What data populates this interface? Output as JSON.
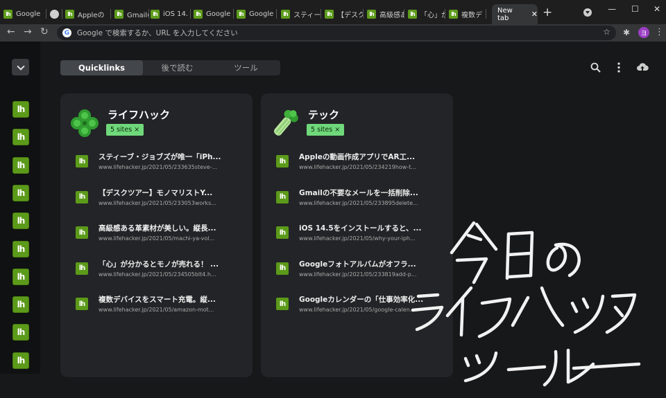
{
  "tabs": [
    {
      "label": "Google",
      "fav": "lh"
    },
    {
      "label": "",
      "fav": "grey"
    },
    {
      "label": "Appleの",
      "fav": "lh"
    },
    {
      "label": "Gmailの",
      "fav": "lh"
    },
    {
      "label": "iOS 14.",
      "fav": "lh"
    },
    {
      "label": "Google",
      "fav": "lh"
    },
    {
      "label": "Google",
      "fav": "lh"
    },
    {
      "label": "スティーブ",
      "fav": "lh"
    },
    {
      "label": "【デスクツ",
      "fav": "lh"
    },
    {
      "label": "高級感あ",
      "fav": "lh"
    },
    {
      "label": "「心」が",
      "fav": "lh"
    },
    {
      "label": "複数デ",
      "fav": "lh"
    }
  ],
  "active_tab": {
    "label": "New tab",
    "close": "✕"
  },
  "new_tab_glyph": "+",
  "window_controls": {
    "minimize": "—",
    "maximize": "☐",
    "close": "✕"
  },
  "omnibox": {
    "placeholder": "Google で検索するか、URL を入力してください",
    "g": "G"
  },
  "profile_initial": "ヨ",
  "favicon_text": "lh",
  "segments": [
    "Quicklinks",
    "後で読む",
    "ツール"
  ],
  "cards": [
    {
      "title": "ライフハック",
      "badge": "5 sites ×",
      "icon": "clover-icon",
      "links": [
        {
          "title": "スティーブ・ジョブズが唯一「iPh...",
          "url": "www.lifehacker.jp/2021/05/233635steve-..."
        },
        {
          "title": "【デスクツアー】モノマリストY...",
          "url": "www.lifehacker.jp/2021/05/233053works..."
        },
        {
          "title": "高級感ある革素材が美しい。縦長...",
          "url": "www.lifehacker.jp/2021/05/machi-ya-vol..."
        },
        {
          "title": "「心」が分かるとモノが売れる！ ...",
          "url": "www.lifehacker.jp/2021/05/234505blt4.h..."
        },
        {
          "title": "複数デバイスをスマート充電。縦...",
          "url": "www.lifehacker.jp/2021/05/amazon-mot..."
        }
      ]
    },
    {
      "title": "テック",
      "badge": "5 sites ×",
      "icon": "celery-icon",
      "links": [
        {
          "title": "Appleの動画作成アプリでAR工...",
          "url": "www.lifehacker.jp/2021/05/234219how-t..."
        },
        {
          "title": "Gmailの不要なメールを一括削除...",
          "url": "www.lifehacker.jp/2021/05/233895delete..."
        },
        {
          "title": "iOS 14.5をインストールすると、...",
          "url": "www.lifehacker.jp/2021/05/why-your-iph..."
        },
        {
          "title": "Googleフォトアルバムがオフラ...",
          "url": "www.lifehacker.jp/2021/05/233819add-p..."
        },
        {
          "title": "Googleカレンダーの「仕事効率化...",
          "url": "www.lifehacker.jp/2021/05/google-calen..."
        }
      ]
    }
  ],
  "colors": {
    "accent_green": "#5c9a1a",
    "badge_green": "#6fd87a",
    "profile": "#9b3fc4"
  }
}
